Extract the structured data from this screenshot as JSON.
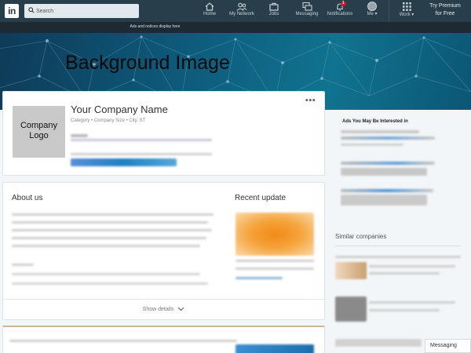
{
  "nav": {
    "logo": "in",
    "search_placeholder": "Search",
    "items": [
      {
        "label": "Home",
        "icon": "home-icon"
      },
      {
        "label": "My Network",
        "icon": "network-icon"
      },
      {
        "label": "Jobs",
        "icon": "jobs-icon"
      },
      {
        "label": "Messaging",
        "icon": "messaging-icon"
      },
      {
        "label": "Notifications",
        "icon": "bell-icon",
        "badge": "1"
      },
      {
        "label": "Me ▾",
        "icon": "avatar"
      },
      {
        "label": "Work ▾",
        "icon": "grid-icon"
      }
    ],
    "premium_line1": "Try Premium",
    "premium_line2": "for Free"
  },
  "ads_notice": "Ads and notices display here",
  "hero": {
    "title": "Background Image"
  },
  "company": {
    "logo_line1": "Company",
    "logo_line2": "Logo",
    "name": "Your Company Name",
    "meta": "Category • Company Size  •  City, ST",
    "menu": "•••"
  },
  "about": {
    "title": "About us",
    "recent_title": "Recent update",
    "show_details": "Show details"
  },
  "rail": {
    "ads_title": "Ads You May Be Interested in",
    "similar_title": "Similar companies"
  },
  "messaging": "Messaging",
  "colors": {
    "nav_bg": "#283e4a",
    "link_blue": "#0073b1",
    "accent_orange": "#f5a33a"
  }
}
